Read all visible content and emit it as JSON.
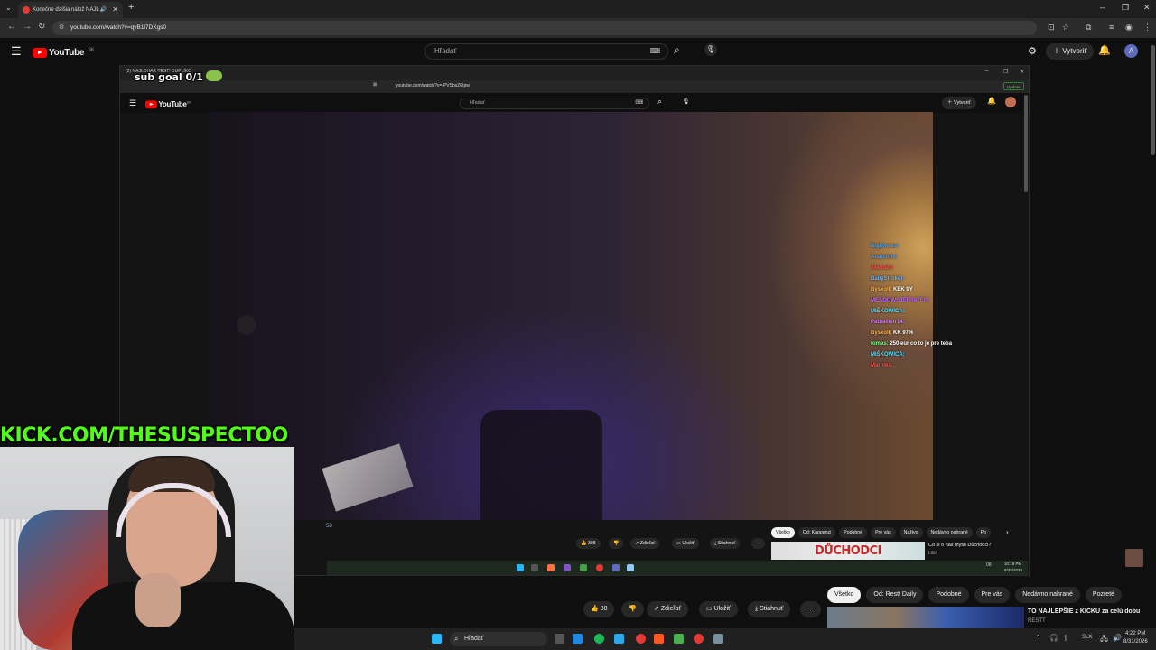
{
  "browser": {
    "tab_title": "Konečne ďalšia nálož NAJL",
    "new_tab": "+",
    "url": "youtube.com/watch?v=qyB1l7DXgs0",
    "window_controls": [
      "–",
      "❐",
      "✕"
    ]
  },
  "youtube": {
    "logo_text": "YouTube",
    "region": "SK",
    "search_placeholder": "Hľadať",
    "create_label": "Vytvoriť",
    "avatar_letter": "A"
  },
  "overlay": {
    "sub_goal": "sub goal 0/1",
    "kick_url": "KICK.COM/THESUSPECTOO"
  },
  "inner_window": {
    "tab_title": "(2) NAJLOHAR TEST! DUPLÍKO",
    "url": "youtube.com/watch?v=-PVSbsZ6Ipw",
    "update_label": "Update",
    "logo_text": "YouTube",
    "region": "SK",
    "search_placeholder": "Hľadať",
    "create_label": "Vytvoriť",
    "like_count": "308",
    "share_label": "Zdieľať",
    "save_label": "Uložiť",
    "download_label": "Stiahnuť",
    "time_fragment": "58",
    "chips": [
      "Všetko",
      "Od: Kappenzi",
      "Podobné",
      "Pre vás",
      "Naživo",
      "Nedávno nahrané",
      "Po"
    ],
    "rec_thumb_text": "DŮCHODCI",
    "rec_title": "Co si o nás myslí Důchodci?",
    "rec_channel": "Lilith",
    "taskbar_time": "10:19 PM",
    "taskbar_date": "8/25/2026",
    "taskbar_lang": "08"
  },
  "chat": [
    {
      "user": "BigSmoke:",
      "msg": "",
      "color": "#46a7ff"
    },
    {
      "user": "Anarchmi:",
      "msg": "",
      "color": "#4aa3ff"
    },
    {
      "user": "J4e0n23:",
      "msg": "",
      "color": "#ff4d4d"
    },
    {
      "user": "BabyStroker:",
      "msg": "",
      "color": "#6bb4ff"
    },
    {
      "user": "Bysxoll:",
      "msg": "KEK 9Y",
      "color": "#ffb84d"
    },
    {
      "user": "MEADOWSJEFRATER:",
      "msg": "",
      "color": "#c468ff"
    },
    {
      "user": "MIŠKOWICA:",
      "msg": "",
      "color": "#5be0ff"
    },
    {
      "user": "Patballistr14:",
      "msg": "",
      "color": "#d07bff"
    },
    {
      "user": "Bysxoll:",
      "msg": "KK 97%",
      "color": "#ffb84d"
    },
    {
      "user": "tomas:",
      "msg": "250 eur co to je pre teba",
      "color": "#7dff8a"
    },
    {
      "user": "MIŠKOWICA:",
      "msg": "",
      "color": "#5be0ff"
    },
    {
      "user": "Marinka:",
      "msg": "",
      "color": "#ff4d4d"
    }
  ],
  "actions": {
    "like_count": "88",
    "share_label": "Zdieľať",
    "save_label": "Uložiť",
    "download_label": "Stiahnuť"
  },
  "chips": [
    "Všetko",
    "Od: Restt Daily",
    "Podobné",
    "Pre vás",
    "Nedávno nahrané",
    "Pozreté"
  ],
  "recommendation": {
    "title": "TO NAJLEPŠIE z KICKU za celú dobu",
    "channel": "RESTT"
  },
  "taskbar": {
    "search_placeholder": "Hľadať",
    "lang": "SLK",
    "time": "4:22 PM",
    "date": "8/31/2026"
  },
  "colors": {
    "yt_red": "#ff0000",
    "kick_green": "#53fc18",
    "background": "#0f0f0f",
    "chip_active": "#f1f1f1"
  }
}
